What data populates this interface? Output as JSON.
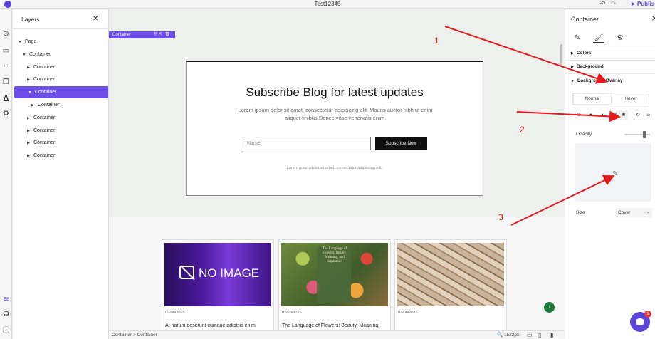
{
  "window": {
    "title": "Test12345",
    "publish_label": "Publis"
  },
  "rail_icons": [
    "plus-circle-icon",
    "rectangle-icon",
    "dots-grid-icon",
    "pages-icon",
    "typography-icon",
    "settings-gear-icon",
    "layers-stack-icon",
    "headset-icon",
    "info-icon"
  ],
  "layers": {
    "title": "Layers",
    "items": [
      {
        "label": "Page",
        "depth": 0,
        "expanded": true
      },
      {
        "label": "Container",
        "depth": 1,
        "expanded": true
      },
      {
        "label": "Container",
        "depth": 2,
        "expanded": false
      },
      {
        "label": "Container",
        "depth": 2,
        "expanded": false
      },
      {
        "label": "Container",
        "depth": 2,
        "expanded": true,
        "active": true
      },
      {
        "label": "Container",
        "depth": 3,
        "expanded": false
      },
      {
        "label": "Container",
        "depth": 2,
        "expanded": false
      },
      {
        "label": "Container",
        "depth": 2,
        "expanded": false
      },
      {
        "label": "Container",
        "depth": 2,
        "expanded": false
      },
      {
        "label": "Container",
        "depth": 2,
        "expanded": false
      }
    ]
  },
  "canvas": {
    "selection_label": "Container",
    "subscribe": {
      "title": "Subscribe Blog for latest updates",
      "description": "Lorem ipsum dolor sit amet, consectetur adipiscing elit. Mauris auctor nibh ut enim aliquet finibus.Donec vitae venenatis enim.",
      "name_placeholder": "Name",
      "button_label": "Subscribe Now",
      "footer": "Lorem ipsum dolor sit amet, consectetur adipiscing elit."
    },
    "cards": [
      {
        "image": "no-image",
        "image_text": "NO IMAGE",
        "date": "09/08/2025",
        "title": "At harum deserunt cumque adipisci enim"
      },
      {
        "image": "flowers-book",
        "image_text": "The Language of Flowers: Beauty, Meaning, and Inspiration",
        "date": "07/08/2025",
        "title": "The Language of Flowers: Beauty, Meaning, and Inspiration"
      },
      {
        "image": "open-books",
        "date": "07/08/2025",
        "title": ""
      }
    ]
  },
  "bottombar": {
    "crumb_1": "Container",
    "crumb_sep": ">",
    "crumb_2": "Container",
    "zoom": "1532px"
  },
  "right_panel": {
    "title": "Container",
    "tabs": [
      "pencil-icon",
      "brush-icon",
      "gear-icon"
    ],
    "active_tab": 1,
    "sections": {
      "colors": "Colors",
      "background": "Background",
      "background_overlay": "Background Overlay"
    },
    "state_tabs": [
      "Normal",
      "Hover"
    ],
    "active_state": "Normal",
    "opacity_label": "Opacity",
    "opacity_value": 0.8,
    "size_label": "Size",
    "size_value": "Cover"
  },
  "chat": {
    "badge": "1"
  },
  "annotations": {
    "labels": [
      "1",
      "2",
      "3"
    ],
    "color": "#e21a1a"
  }
}
